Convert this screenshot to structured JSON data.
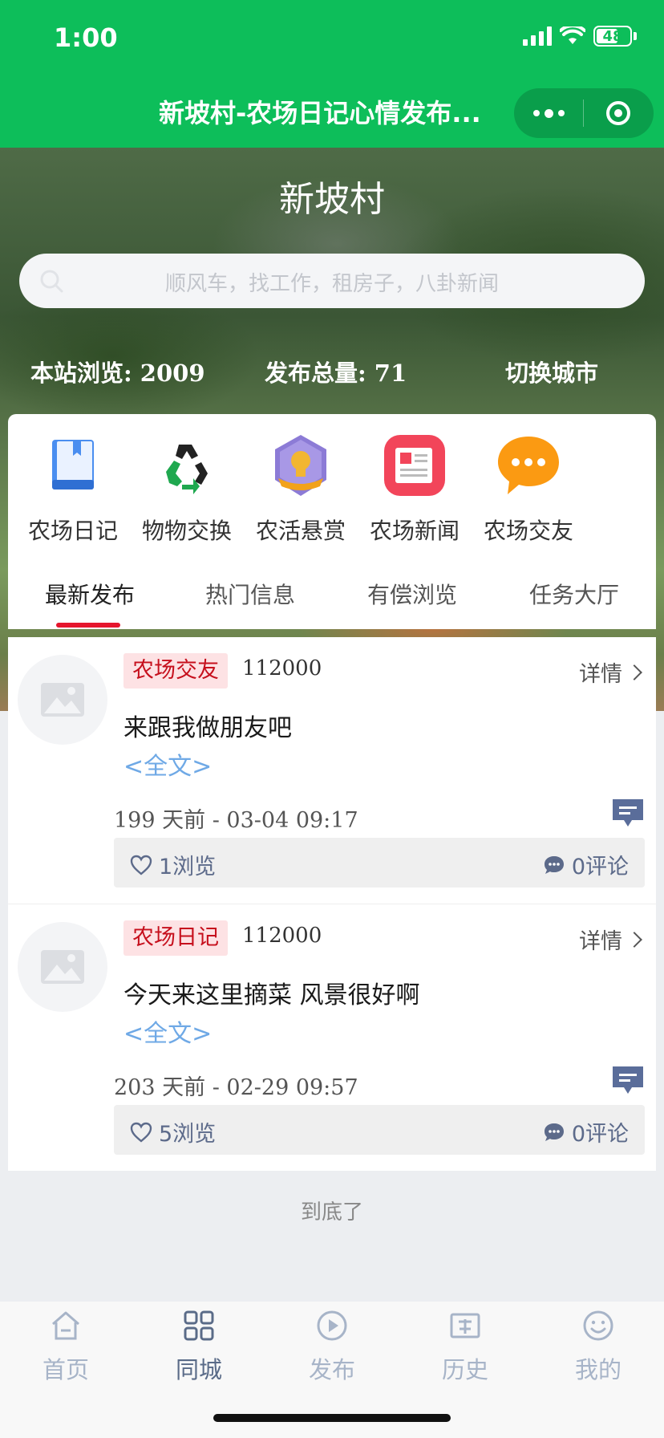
{
  "status": {
    "time": "1:00",
    "battery": "48"
  },
  "nav": {
    "title": "新坡村-农场日记心情发布..."
  },
  "hero": {
    "title": "新坡村",
    "search_placeholder": "顺风车，找工作，租房子，八卦新闻",
    "stats": {
      "views": "本站浏览: 2009",
      "posts": "发布总量: 71",
      "switch_city": "切换城市"
    }
  },
  "categories": [
    {
      "label": "农场日记",
      "icon": "book-icon"
    },
    {
      "label": "物物交换",
      "icon": "recycle-icon"
    },
    {
      "label": "农活悬赏",
      "icon": "badge-icon"
    },
    {
      "label": "农场新闻",
      "icon": "news-icon"
    },
    {
      "label": "农场交友",
      "icon": "chat-bubble-icon"
    }
  ],
  "tabs": [
    "最新发布",
    "热门信息",
    "有偿浏览",
    "任务大厅"
  ],
  "posts": [
    {
      "tag": "农场交友",
      "number": "112000",
      "detail": "详情",
      "text": "来跟我做朋友吧",
      "full": "<全文>",
      "time": "199 天前 - 03-04 09:17",
      "views": "1浏览",
      "comments": "0评论"
    },
    {
      "tag": "农场日记",
      "number": "112000",
      "detail": "详情",
      "text": "今天来这里摘菜 风景很好啊",
      "full": "<全文>",
      "time": "203 天前 - 02-29 09:57",
      "views": "5浏览",
      "comments": "0评论"
    }
  ],
  "end_text": "到底了",
  "tabbar": [
    {
      "label": "首页",
      "icon": "home-icon"
    },
    {
      "label": "同城",
      "icon": "grid-icon",
      "active": true
    },
    {
      "label": "发布",
      "icon": "play-icon"
    },
    {
      "label": "历史",
      "icon": "history-icon"
    },
    {
      "label": "我的",
      "icon": "smile-icon"
    }
  ],
  "colors": {
    "brand_green": "#0dbe5a",
    "tag_red": "#c6101d",
    "link_blue": "#6fa9e6",
    "tab_active_underline": "#e5162d"
  }
}
